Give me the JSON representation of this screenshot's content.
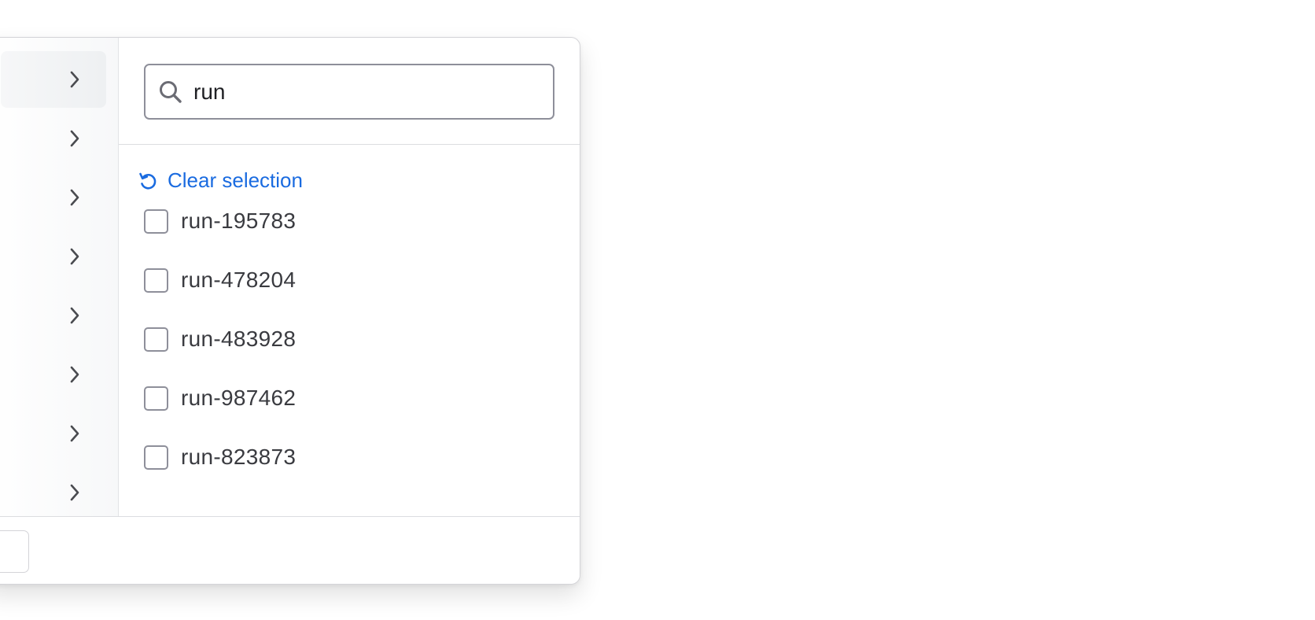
{
  "search": {
    "value": "run",
    "icon": "search-icon"
  },
  "clear": {
    "label": "Clear selection",
    "icon": "reset-icon",
    "color": "#1a6be0"
  },
  "options": [
    {
      "label": "run-195783",
      "checked": false
    },
    {
      "label": "run-478204",
      "checked": false
    },
    {
      "label": "run-483928",
      "checked": false
    },
    {
      "label": "run-987462",
      "checked": false
    },
    {
      "label": "run-823873",
      "checked": false
    }
  ],
  "categories": {
    "icon": "chevron-right-icon"
  }
}
